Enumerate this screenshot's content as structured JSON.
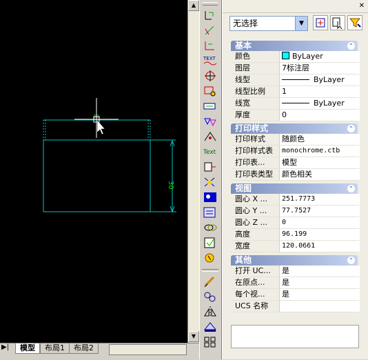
{
  "app": {
    "accent": "#00c4c4",
    "canvas_bg": "#000000"
  },
  "drawing": {
    "dimension_text": "30",
    "small_text": "20"
  },
  "layout_tabs": [
    {
      "label": "模型",
      "active": true
    },
    {
      "label": "布局1",
      "active": false
    },
    {
      "label": "布局2",
      "active": false
    }
  ],
  "toolbar_icons": [
    "dimension-linear-icon",
    "dimension-aligned-icon",
    "dimension-ordinate-icon",
    "text-style-icon",
    "center-mark-icon",
    "tolerance-icon",
    "dimension-edit-icon",
    "arc-length-icon",
    "dim-style-icon",
    "text-icon",
    "insert-block-icon",
    "measure-icon",
    "design-center-icon",
    "tool-palette-icon",
    "link-icon",
    "quick-select-icon",
    "match-properties-icon",
    "chain-icon",
    "mirror-icon",
    "stretch-icon",
    "array-icon"
  ],
  "properties": {
    "selection": "无选择",
    "sections": [
      {
        "title": "基本",
        "rows": [
          {
            "label": "颜色",
            "value": "ByLayer",
            "kind": "color",
            "color": "#00ffff"
          },
          {
            "label": "图层",
            "value": "7标注层"
          },
          {
            "label": "线型",
            "value": "ByLayer",
            "kind": "line"
          },
          {
            "label": "线型比例",
            "value": "1"
          },
          {
            "label": "线宽",
            "value": "ByLayer",
            "kind": "line"
          },
          {
            "label": "厚度",
            "value": "0"
          }
        ]
      },
      {
        "title": "打印样式",
        "rows": [
          {
            "label": "打印样式",
            "value": "随颜色"
          },
          {
            "label": "打印样式表",
            "value": "monochrome.ctb",
            "kind": "mono"
          },
          {
            "label": "打印表...",
            "value": "模型"
          },
          {
            "label": "打印表类型",
            "value": "颜色相关"
          }
        ]
      },
      {
        "title": "视图",
        "rows": [
          {
            "label": "圆心 X ...",
            "value": "251.7773"
          },
          {
            "label": "圆心 Y ...",
            "value": "77.7527"
          },
          {
            "label": "圆心 Z ...",
            "value": "0"
          },
          {
            "label": "高度",
            "value": "96.199"
          },
          {
            "label": "宽度",
            "value": "120.0661"
          }
        ]
      },
      {
        "title": "其他",
        "rows": [
          {
            "label": "打开 UC...",
            "value": "是"
          },
          {
            "label": "在原点...",
            "value": "是"
          },
          {
            "label": "每个视...",
            "value": "是"
          },
          {
            "label": "UCS 名称",
            "value": ""
          }
        ]
      }
    ]
  }
}
